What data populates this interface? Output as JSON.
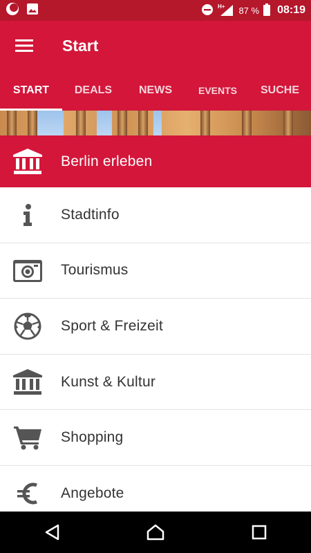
{
  "status_bar": {
    "battery_percent": "87 %",
    "time": "08:19",
    "icons": [
      "notification-moon-icon",
      "image-icon",
      "do-not-disturb-icon",
      "h-plus-signal-icon",
      "battery-icon"
    ]
  },
  "toolbar": {
    "title": "Start",
    "menu_icon": "hamburger-menu-icon"
  },
  "tabs": [
    {
      "label": "START",
      "active": true
    },
    {
      "label": "DEALS",
      "active": false
    },
    {
      "label": "NEWS",
      "active": false
    },
    {
      "label": "EVENTS",
      "active": false
    },
    {
      "label": "SUCHE",
      "active": false
    }
  ],
  "list": [
    {
      "label": "Berlin erleben",
      "icon": "museum-building-icon",
      "highlighted": true
    },
    {
      "label": "Stadtinfo",
      "icon": "info-icon"
    },
    {
      "label": "Tourismus",
      "icon": "camera-icon"
    },
    {
      "label": "Sport & Freizeit",
      "icon": "soccer-ball-icon"
    },
    {
      "label": "Kunst & Kultur",
      "icon": "museum-building-icon"
    },
    {
      "label": "Shopping",
      "icon": "shopping-cart-icon"
    },
    {
      "label": "Angebote",
      "icon": "euro-icon"
    }
  ],
  "nav_bar": {
    "icons": [
      "back-icon",
      "home-icon",
      "recents-icon"
    ]
  },
  "colors": {
    "primary": "#d3163a",
    "status_bar": "#b5172b",
    "icon_gray": "#555555",
    "text": "#333333"
  }
}
